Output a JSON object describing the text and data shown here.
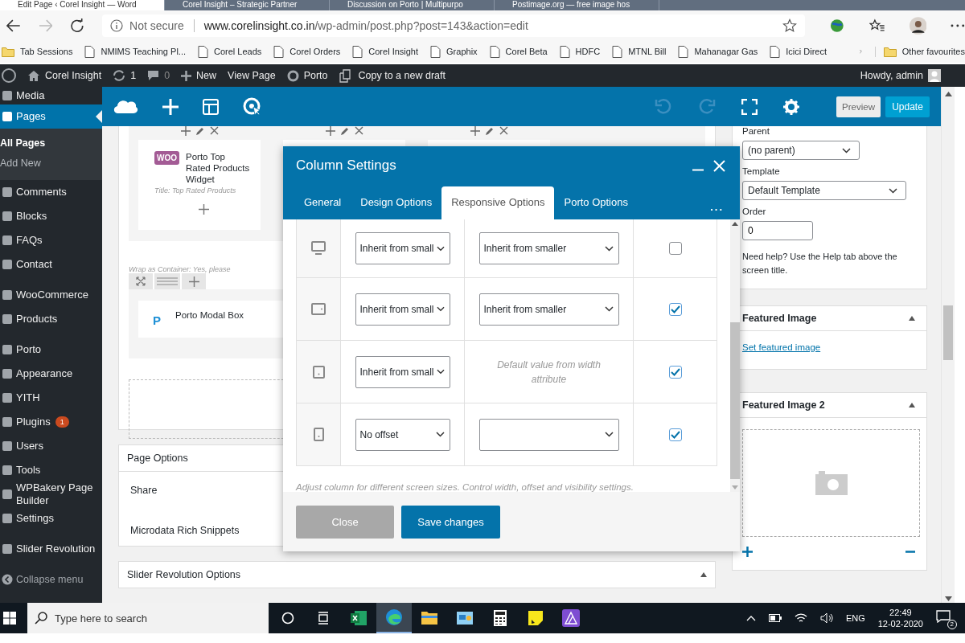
{
  "browser": {
    "tabs": [
      {
        "title": "Edit Page ‹ Corel Insight — Word",
        "selected": true
      },
      {
        "title": "Corel Insight – Strategic Partner",
        "selected": false
      },
      {
        "title": "Discussion on Porto | Multipurpo",
        "selected": false
      },
      {
        "title": "Postimage.org — free image hos",
        "selected": false
      }
    ],
    "address": {
      "security": "Not secure",
      "domain": "www.corelinsight.co.in",
      "path": "/wp-admin/post.php?post=143&action=edit"
    },
    "bookmarks": [
      {
        "label": "Tab Sessions",
        "kind": "folder"
      },
      {
        "label": "NMIMS Teaching Pl...",
        "kind": "page"
      },
      {
        "label": "Corel Leads",
        "kind": "page"
      },
      {
        "label": "Corel Orders",
        "kind": "page"
      },
      {
        "label": "Corel Insight",
        "kind": "page"
      },
      {
        "label": "Graphix",
        "kind": "page"
      },
      {
        "label": "Corel Beta",
        "kind": "page"
      },
      {
        "label": "HDFC",
        "kind": "page"
      },
      {
        "label": "MTNL Bill",
        "kind": "page"
      },
      {
        "label": "Mahanagar Gas",
        "kind": "page"
      },
      {
        "label": "Icici Direct",
        "kind": "page"
      }
    ],
    "other_favourites": "Other favourites"
  },
  "admin_bar": {
    "site": "Corel Insight",
    "updates": "1",
    "comments": "0",
    "new": "New",
    "view_page": "View Page",
    "theme": "Porto",
    "copy_draft": "Copy to a new draft",
    "greeting": "Howdy, admin"
  },
  "sidebar": {
    "groups": [
      {
        "items": [
          {
            "label": "Media",
            "selected": false
          },
          {
            "label": "Pages",
            "selected": true,
            "children": [
              {
                "label": "All Pages",
                "selected": true
              },
              {
                "label": "Add New",
                "selected": false
              }
            ]
          },
          {
            "label": "Comments",
            "selected": false
          },
          {
            "label": "Blocks",
            "selected": false
          },
          {
            "label": "FAQs",
            "selected": false
          },
          {
            "label": "Contact",
            "selected": false
          }
        ]
      },
      {
        "items": [
          {
            "label": "WooCommerce",
            "selected": false
          },
          {
            "label": "Products",
            "selected": false
          }
        ]
      },
      {
        "items": [
          {
            "label": "Porto",
            "selected": false
          },
          {
            "label": "Appearance",
            "selected": false
          },
          {
            "label": "YITH",
            "selected": false
          },
          {
            "label": "Plugins",
            "selected": false,
            "badge": "1"
          },
          {
            "label": "Users",
            "selected": false
          },
          {
            "label": "Tools",
            "selected": false
          },
          {
            "label": "WPBakery Page Builder",
            "selected": false
          },
          {
            "label": "Settings",
            "selected": false
          }
        ]
      },
      {
        "items": [
          {
            "label": "Slider Revolution",
            "selected": false
          }
        ]
      }
    ],
    "collapse": "Collapse menu"
  },
  "toolbar": {
    "preview": "Preview",
    "update": "Update"
  },
  "builder": {
    "widget": {
      "logo": "WOO",
      "title": "Porto Top Rated Products Widget",
      "subtitle": "Title: Top Rated Products"
    },
    "wrap_note": "Wrap as Container: Yes, please",
    "modal_box": {
      "logo": "P",
      "title": "Porto Modal Box"
    }
  },
  "page_options": {
    "title": "Page Options",
    "items": [
      "Share",
      "Microdata Rich Snippets"
    ]
  },
  "slider_options": {
    "title": "Slider Revolution Options"
  },
  "page_attributes": {
    "parent_label": "Parent",
    "parent": "(no parent)",
    "template_label": "Template",
    "template": "Default Template",
    "order_label": "Order",
    "order": "0",
    "help": "Need help? Use the Help tab above the screen title."
  },
  "featured_image": {
    "title": "Featured Image",
    "link": "Set featured image"
  },
  "featured_image_2": {
    "title": "Featured Image 2"
  },
  "modal": {
    "title": "Column Settings",
    "tabs": [
      {
        "label": "General",
        "selected": false
      },
      {
        "label": "Design Options",
        "selected": false
      },
      {
        "label": "Responsive Options",
        "selected": true
      },
      {
        "label": "Porto Options",
        "selected": false
      }
    ],
    "more": "...",
    "rows": [
      {
        "kind": "desktop",
        "offset": "Inherit from small",
        "width": {
          "kind": "select",
          "value": "Inherit from smaller"
        },
        "checked": false
      },
      {
        "kind": "tablet_landscape",
        "offset": "Inherit from small",
        "width": {
          "kind": "select",
          "value": "Inherit from smaller"
        },
        "checked": true
      },
      {
        "kind": "tablet_portrait",
        "offset": "Inherit from small",
        "width": {
          "kind": "note",
          "value": "Default value from width attribute"
        },
        "checked": true
      },
      {
        "kind": "phone",
        "offset": "No offset",
        "width": {
          "kind": "select"
        },
        "checked": true
      }
    ],
    "hint": "Adjust column for different screen sizes. Control width, offset and visibility settings.",
    "close": "Close",
    "save": "Save changes"
  },
  "taskbar": {
    "search_placeholder": "Type here to search",
    "apps": [
      {
        "kind": "spreadsheet",
        "selected": false
      },
      {
        "kind": "browser",
        "selected": true
      },
      {
        "kind": "folder",
        "selected": false
      },
      {
        "kind": "window",
        "selected": false
      },
      {
        "kind": "calculator",
        "selected": false
      },
      {
        "kind": "note",
        "selected": false
      },
      {
        "kind": "triangle",
        "selected": false
      }
    ],
    "language": "ENG",
    "time": "22:49",
    "date": "12-02-2020",
    "notifications": "2"
  }
}
